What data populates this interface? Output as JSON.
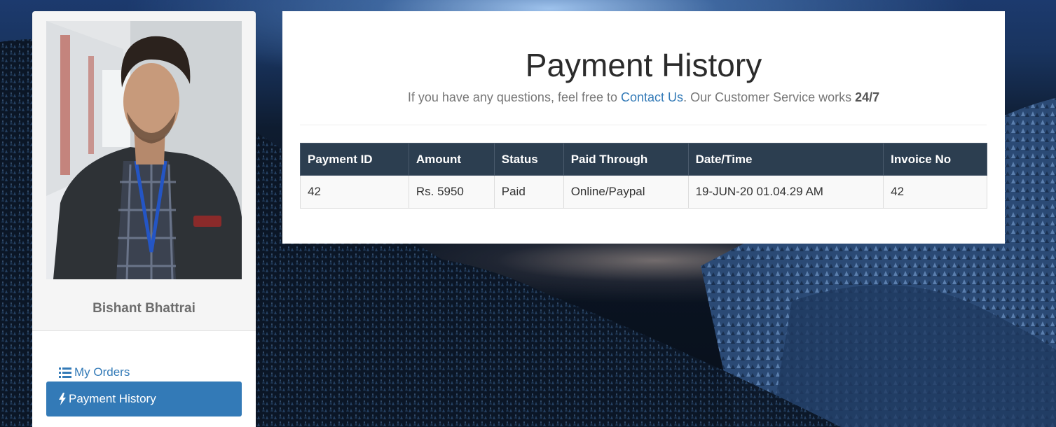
{
  "sidebar": {
    "profile_name": "Bishant Bhattrai",
    "menu": [
      {
        "label": "My Orders",
        "icon": "list-icon"
      },
      {
        "label": "Payment History",
        "icon": "bolt-icon",
        "active": true
      }
    ]
  },
  "main": {
    "title": "Payment History",
    "subtitle_prefix": "If you have any questions, feel free to ",
    "contact_link": "Contact Us",
    "subtitle_middle": ". Our Customer Service works ",
    "subtitle_bold": "24/7",
    "table": {
      "headers": [
        "Payment ID",
        "Amount",
        "Status",
        "Paid Through",
        "Date/Time",
        "Invoice No"
      ],
      "rows": [
        [
          "42",
          "Rs. 5950",
          "Paid",
          "Online/Paypal",
          "19-JUN-20 01.04.29 AM",
          "42"
        ]
      ]
    }
  },
  "colors": {
    "accent": "#337ab7",
    "table_header": "#2c3e50",
    "status_paid": "#3c763d"
  }
}
